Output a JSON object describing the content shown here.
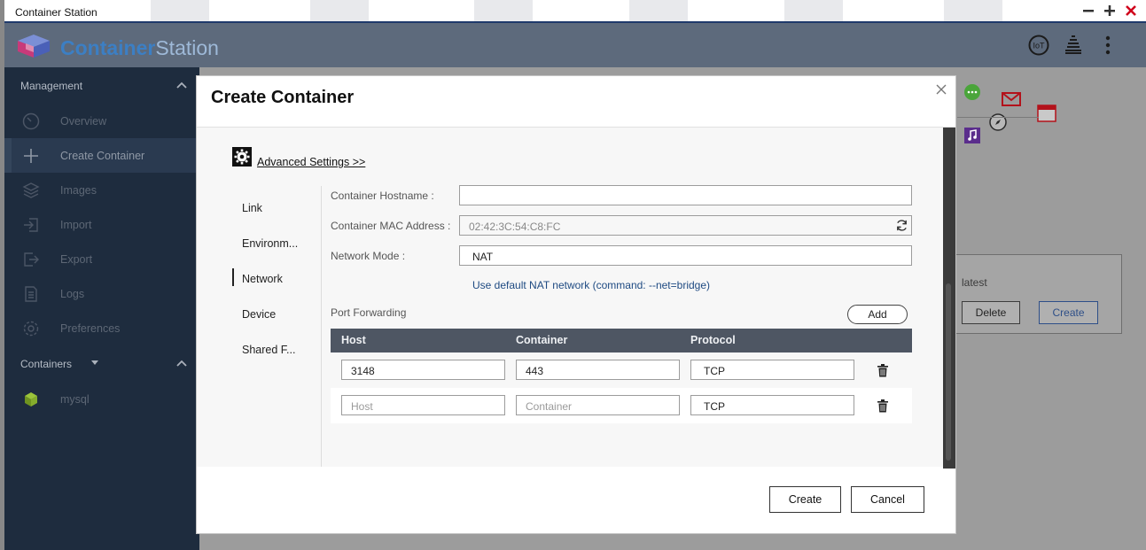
{
  "window": {
    "title": "Container Station"
  },
  "header": {
    "brand_bold": "Container",
    "brand_light": "Station",
    "iot_label": "IoT"
  },
  "sidebar": {
    "management_label": "Management",
    "items": [
      {
        "label": "Overview",
        "icon": "gauge-icon"
      },
      {
        "label": "Create Container",
        "icon": "plus-icon"
      },
      {
        "label": "Images",
        "icon": "layers-icon"
      },
      {
        "label": "Import",
        "icon": "import-icon"
      },
      {
        "label": "Export",
        "icon": "export-icon"
      },
      {
        "label": "Logs",
        "icon": "document-icon"
      },
      {
        "label": "Preferences",
        "icon": "gear-icon"
      }
    ],
    "containers_label": "Containers",
    "containers": [
      {
        "label": "mysql",
        "icon": "cube-icon"
      }
    ]
  },
  "background": {
    "latest_label": "latest",
    "delete_label": "Delete",
    "create_label": "Create"
  },
  "modal": {
    "title": "Create Container",
    "advanced_settings": "Advanced Settings >>",
    "tabs": [
      "Link",
      "Environm...",
      "Network",
      "Device",
      "Shared F..."
    ],
    "active_tab": "Network",
    "hostname_label": "Container Hostname :",
    "hostname_value": "",
    "mac_label": "Container MAC Address :",
    "mac_value": "02:42:3C:54:C8:FC",
    "mode_label": "Network Mode :",
    "mode_value": "NAT",
    "nat_note": "Use default NAT network (command: --net=bridge)",
    "port_forwarding_label": "Port Forwarding",
    "add_label": "Add",
    "table_headers": {
      "host": "Host",
      "container": "Container",
      "protocol": "Protocol"
    },
    "rows": [
      {
        "host": "3148",
        "container": "443",
        "protocol": "TCP"
      },
      {
        "host_placeholder": "Host",
        "container_placeholder": "Container",
        "protocol": "TCP"
      }
    ],
    "create_label": "Create",
    "cancel_label": "Cancel"
  }
}
